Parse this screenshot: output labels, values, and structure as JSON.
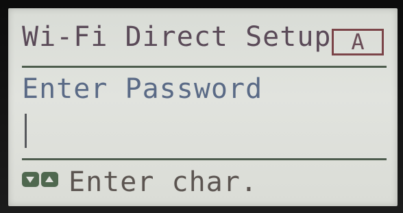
{
  "screen": {
    "title": "Wi-Fi Direct Setup",
    "input_mode": "A"
  },
  "password_entry": {
    "prompt": "Enter Password",
    "value": ""
  },
  "footer": {
    "left_icon": "down-arrow-key-icon",
    "right_icon": "up-arrow-key-icon",
    "hint": "Enter char."
  },
  "colors": {
    "lcd_background": "#dfe1dc",
    "title_text": "#5a4a58",
    "prompt_text": "#5a6a86",
    "divider": "#4d5c4d",
    "badge_border": "#7b4448",
    "key_icon": "#4f684f"
  }
}
